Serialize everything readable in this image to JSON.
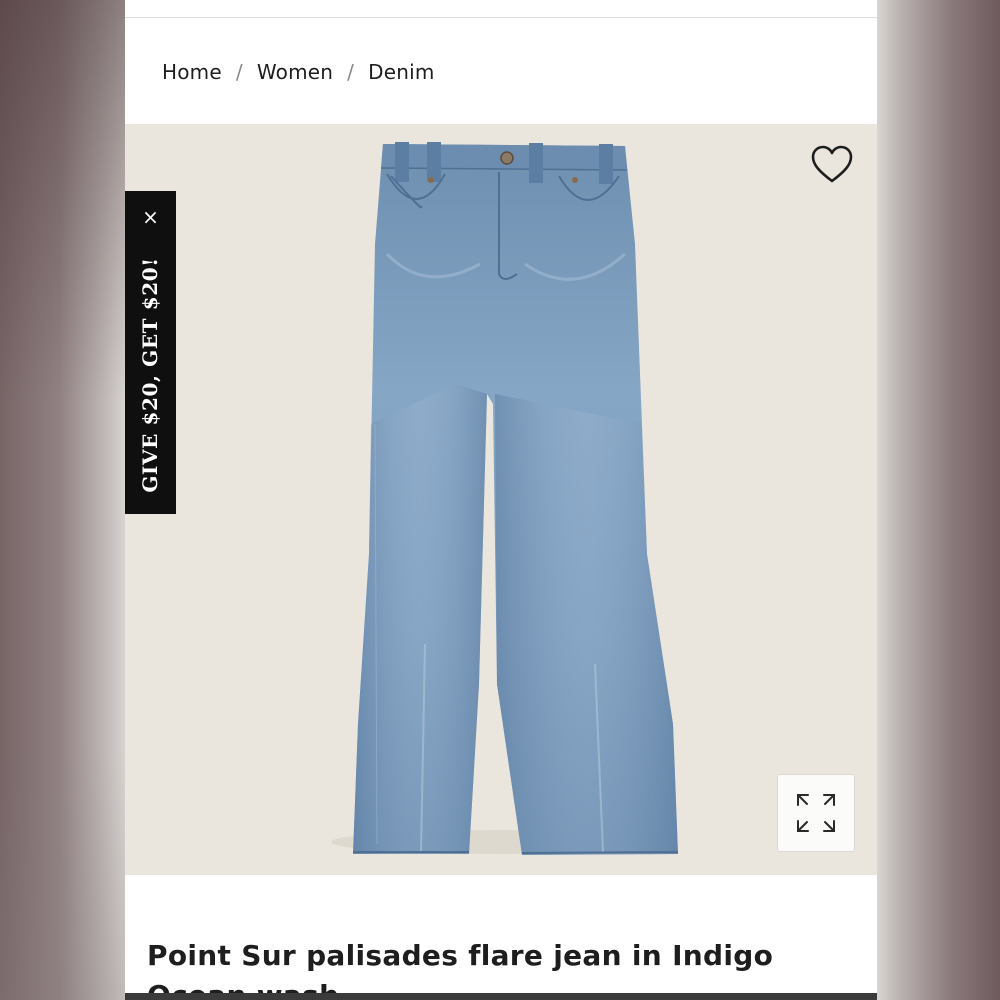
{
  "breadcrumb": {
    "items": [
      "Home",
      "Women",
      "Denim"
    ],
    "separator": "/"
  },
  "product": {
    "title": "Point Sur palisades flare jean in Indigo Ocean wash",
    "image_alt": "Light wash flare jeans"
  },
  "promo": {
    "text": "GIVE $20, GET $20!",
    "close_glyph": "×"
  },
  "icons": {
    "favorite": "heart-outline-icon",
    "zoom": "expand-icon"
  },
  "colors": {
    "page_background": "#ffffff",
    "hero_background": "#ebe6dd",
    "promo_background": "#0f0f0f",
    "denim": "#7d9dbd",
    "text": "#1e1e1e"
  }
}
